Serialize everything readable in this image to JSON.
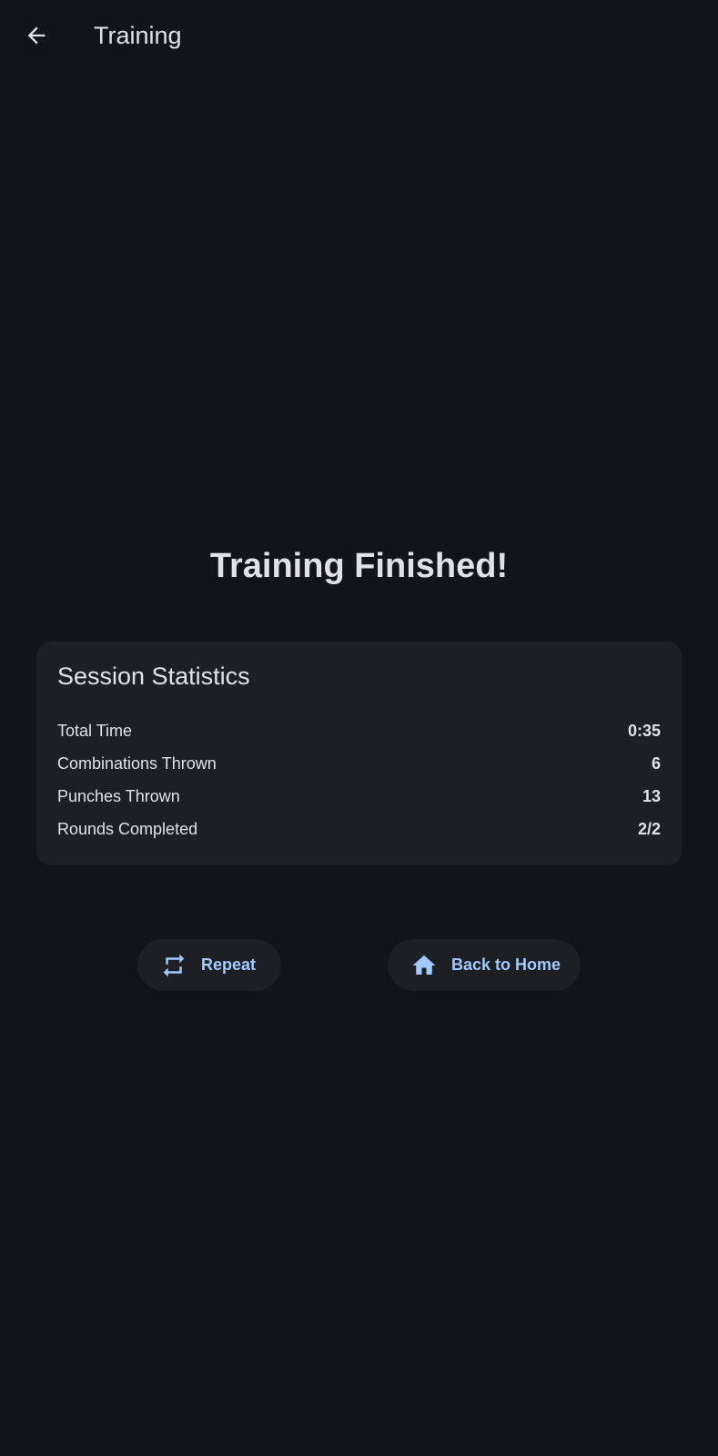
{
  "header": {
    "title": "Training",
    "back_icon": "arrow-back-icon"
  },
  "headline": "Training Finished!",
  "stats_card": {
    "title": "Session Statistics",
    "rows": [
      {
        "label": "Total Time",
        "value": "0:35"
      },
      {
        "label": "Combinations Thrown",
        "value": "6"
      },
      {
        "label": "Punches Thrown",
        "value": "13"
      },
      {
        "label": "Rounds Completed",
        "value": "2/2"
      }
    ]
  },
  "actions": {
    "repeat": {
      "label": "Repeat",
      "icon": "repeat-icon"
    },
    "home": {
      "label": "Back to Home",
      "icon": "home-icon"
    }
  },
  "colors": {
    "background": "#111418",
    "surface": "#1c1f24",
    "text": "#e2e2e6",
    "accent": "#a3c9fe"
  }
}
